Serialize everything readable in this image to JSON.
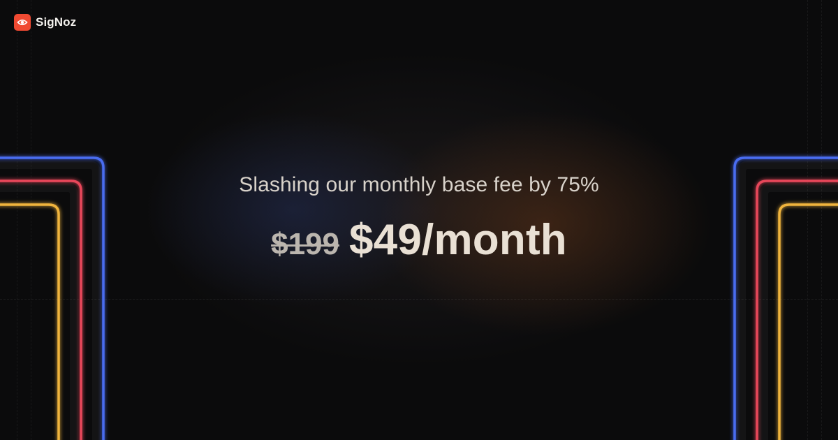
{
  "brand": {
    "name": "SigNoz",
    "logo_icon": "eye-icon",
    "logo_color": "#f04a32"
  },
  "headline": "Slashing our monthly base fee by 75%",
  "pricing": {
    "old_price": "$199",
    "new_price": "$49/month"
  },
  "colors": {
    "background": "#0b0b0c",
    "frame_blue": "#4a6cf0",
    "frame_red": "#e8475a",
    "frame_yellow": "#f0b43c",
    "text_primary": "#e9e0d4",
    "text_secondary": "#d8d2ca"
  }
}
